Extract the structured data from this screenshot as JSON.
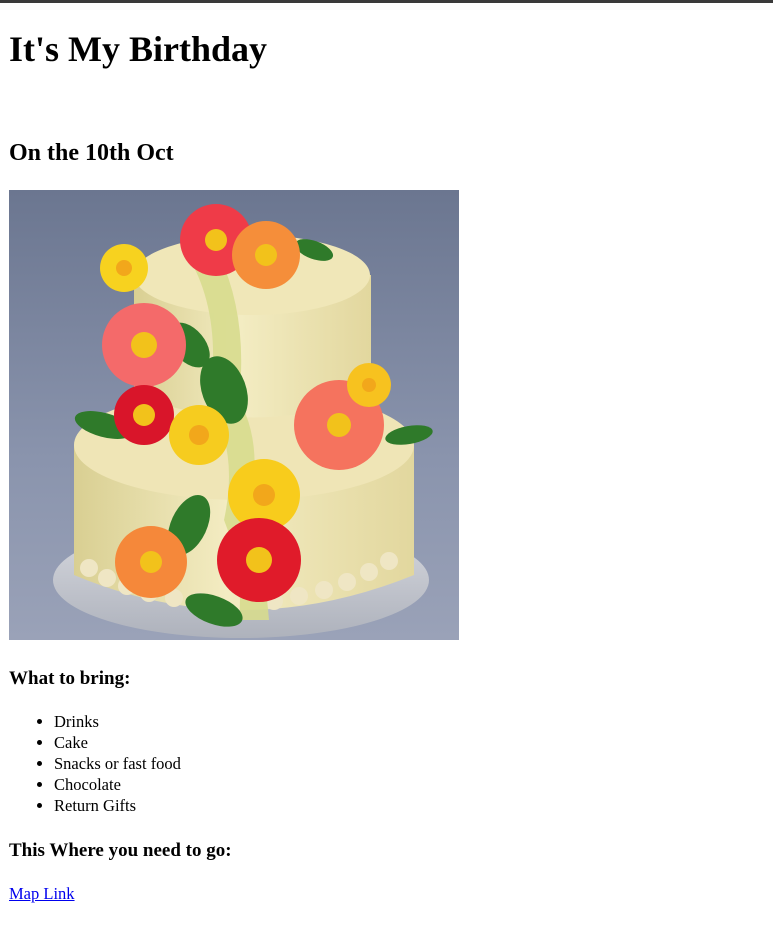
{
  "title": "It's My Birthday",
  "date_heading": "On the 10th Oct",
  "image": {
    "subject": "two-tier cream cake decorated with colorful gerbera flowers"
  },
  "bring": {
    "heading": "What to bring:",
    "items": [
      "Drinks",
      "Cake",
      "Snacks or fast food",
      "Chocolate",
      "Return Gifts"
    ]
  },
  "directions": {
    "heading": "This Where you need to go:",
    "link_label": "Map Link"
  },
  "colors": {
    "link": "#0000ee",
    "photo_background": "#7b86a0",
    "cake_body": "#f1e6b4"
  }
}
